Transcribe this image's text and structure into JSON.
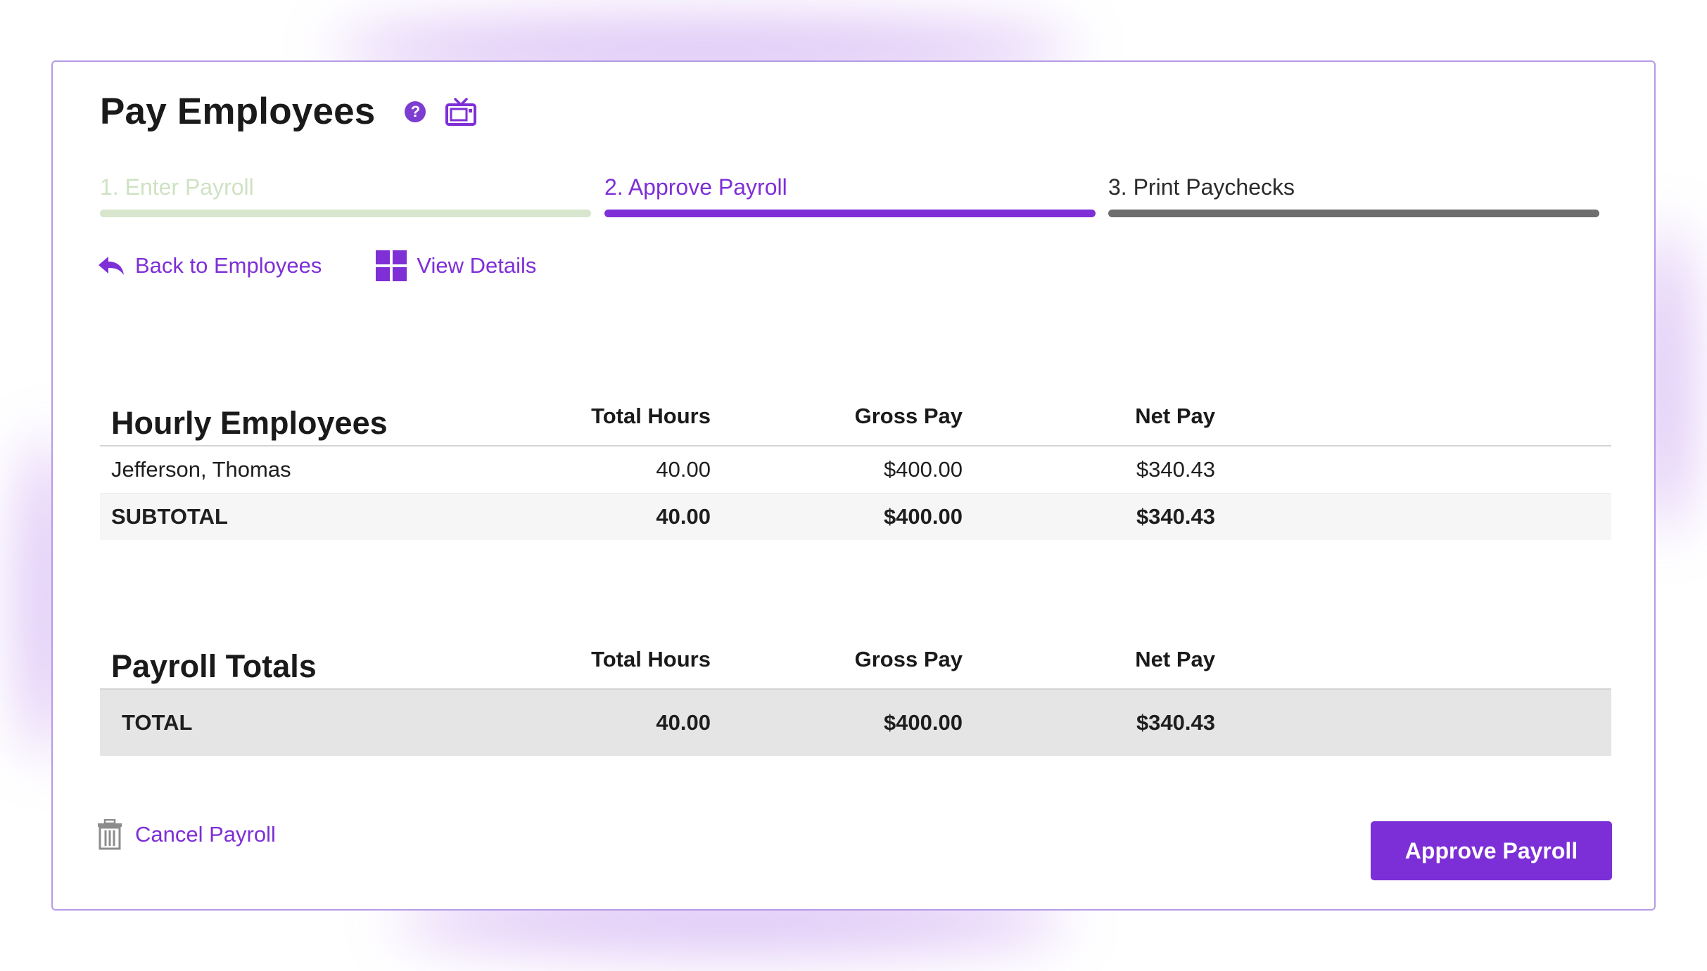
{
  "page": {
    "title": "Pay Employees",
    "help_icon": "question-circle-icon",
    "video_icon": "tv-icon"
  },
  "steps": [
    {
      "label": "1. Enter Payroll",
      "state": "completed",
      "label_color": "#cfe2c3",
      "bar_color": "#d7e6cc"
    },
    {
      "label": "2. Approve Payroll",
      "state": "active",
      "label_color": "#7e2fd6",
      "bar_color": "#7e2fd6"
    },
    {
      "label": "3. Print Paychecks",
      "state": "upcoming",
      "label_color": "#2b2b2b",
      "bar_color": "#6e6e6e"
    }
  ],
  "actions": {
    "back_label": "Back to Employees",
    "back_icon": "reply-arrow-icon",
    "details_label": "View Details",
    "details_icon": "grid-icon"
  },
  "hourly_table": {
    "title": "Hourly Employees",
    "columns": [
      "Total Hours",
      "Gross Pay",
      "Net Pay"
    ],
    "rows": [
      {
        "name": "Jefferson, Thomas",
        "hours": "40.00",
        "gross": "$400.00",
        "net": "$340.43"
      }
    ],
    "subtotal": {
      "label": "SUBTOTAL",
      "hours": "40.00",
      "gross": "$400.00",
      "net": "$340.43"
    }
  },
  "totals_table": {
    "title": "Payroll Totals",
    "columns": [
      "Total Hours",
      "Gross Pay",
      "Net Pay"
    ],
    "total": {
      "label": "TOTAL",
      "hours": "40.00",
      "gross": "$400.00",
      "net": "$340.43"
    }
  },
  "footer": {
    "cancel_label": "Cancel Payroll",
    "cancel_icon": "trash-icon",
    "approve_label": "Approve Payroll"
  },
  "colors": {
    "accent": "#7e2fd6",
    "card_border": "#b49be6",
    "subtotal_bg": "#f6f6f6",
    "total_bg": "#e5e5e5"
  }
}
